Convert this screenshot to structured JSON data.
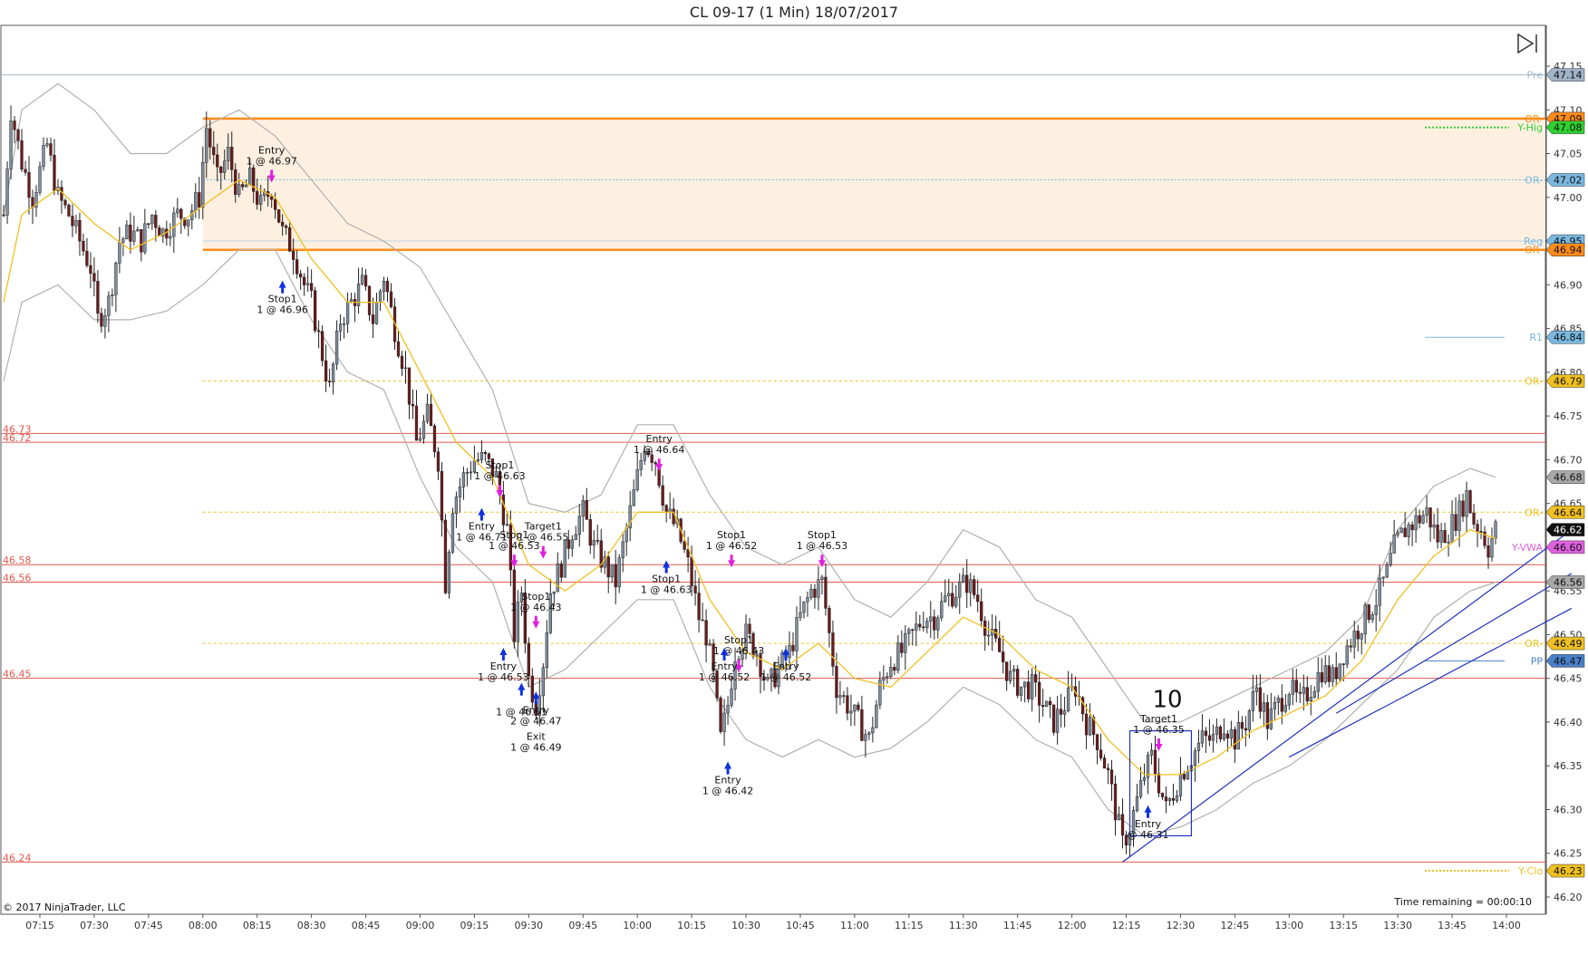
{
  "window": {
    "title": "CL 09-17 (1 Min)  18/07/2017"
  },
  "footer": {
    "copyright": "© 2017 NinjaTrader, LLC",
    "time_remaining": "Time remaining = 00:00:10"
  },
  "colors": {
    "up_candle": "#7f8f9f",
    "down_candle": "#6b1a1a",
    "ema": "#f0c020",
    "bands": "#b0b0b0",
    "or_range_fill": "#fdf0e0",
    "or_line": "#ff8c1a",
    "red_level": "#e05a4f",
    "yellow_dash": "#f0c020",
    "entry_arrow": "#1030e0",
    "exit_arrow": "#e020e0",
    "trendline": "#2030c0"
  },
  "chart_data": {
    "type": "candlestick",
    "symbol": "CL 09-17",
    "interval": "1 Min",
    "date": "18/07/2017",
    "ylim": [
      46.18,
      47.17
    ],
    "y_ticks": [
      46.2,
      46.25,
      46.3,
      46.35,
      46.4,
      46.45,
      46.5,
      46.55,
      46.6,
      46.65,
      46.7,
      46.75,
      46.8,
      46.85,
      46.9,
      46.95,
      47.0,
      47.05,
      47.1,
      47.15
    ],
    "x_ticks": [
      "07:15",
      "07:30",
      "07:45",
      "08:00",
      "08:15",
      "08:30",
      "08:45",
      "09:00",
      "09:15",
      "09:30",
      "09:45",
      "10:00",
      "10:15",
      "10:30",
      "10:45",
      "11:00",
      "11:15",
      "11:30",
      "11:45",
      "12:00",
      "12:15",
      "12:30",
      "12:45",
      "13:00",
      "13:15",
      "13:30",
      "13:45",
      "14:00"
    ],
    "x_tick_minutes": [
      435,
      450,
      465,
      480,
      495,
      510,
      525,
      540,
      555,
      570,
      585,
      600,
      615,
      630,
      645,
      660,
      675,
      690,
      705,
      720,
      735,
      750,
      765,
      780,
      795,
      810,
      825,
      840
    ],
    "close_path": [
      [
        425,
        46.98
      ],
      [
        427,
        47.1
      ],
      [
        430,
        47.04
      ],
      [
        433,
        47.0
      ],
      [
        437,
        47.06
      ],
      [
        440,
        47.0
      ],
      [
        443,
        46.98
      ],
      [
        446,
        46.95
      ],
      [
        449,
        46.92
      ],
      [
        451,
        46.86
      ],
      [
        454,
        46.88
      ],
      [
        457,
        46.95
      ],
      [
        460,
        46.96
      ],
      [
        463,
        46.95
      ],
      [
        466,
        46.98
      ],
      [
        469,
        46.96
      ],
      [
        473,
        46.98
      ],
      [
        476,
        46.98
      ],
      [
        479,
        47.0
      ],
      [
        481,
        47.08
      ],
      [
        484,
        47.02
      ],
      [
        487,
        47.05
      ],
      [
        490,
        47.0
      ],
      [
        493,
        47.02
      ],
      [
        496,
        46.99
      ],
      [
        499,
        47.01
      ],
      [
        502,
        46.96
      ],
      [
        505,
        46.94
      ],
      [
        508,
        46.9
      ],
      [
        510,
        46.88
      ],
      [
        513,
        46.82
      ],
      [
        515,
        46.78
      ],
      [
        518,
        46.86
      ],
      [
        521,
        46.88
      ],
      [
        524,
        46.9
      ],
      [
        527,
        46.86
      ],
      [
        530,
        46.91
      ],
      [
        533,
        46.85
      ],
      [
        536,
        46.8
      ],
      [
        539,
        46.72
      ],
      [
        542,
        46.75
      ],
      [
        545,
        46.7
      ],
      [
        547,
        46.56
      ],
      [
        549,
        46.65
      ],
      [
        552,
        46.68
      ],
      [
        555,
        46.7
      ],
      [
        558,
        46.7
      ],
      [
        561,
        46.68
      ],
      [
        564,
        46.62
      ],
      [
        566,
        46.5
      ],
      [
        568,
        46.55
      ],
      [
        570,
        46.45
      ],
      [
        572,
        46.42
      ],
      [
        574,
        46.47
      ],
      [
        576,
        46.55
      ],
      [
        579,
        46.58
      ],
      [
        582,
        46.62
      ],
      [
        585,
        46.64
      ],
      [
        588,
        46.6
      ],
      [
        591,
        46.58
      ],
      [
        594,
        46.56
      ],
      [
        597,
        46.62
      ],
      [
        600,
        46.68
      ],
      [
        602,
        46.72
      ],
      [
        605,
        46.7
      ],
      [
        608,
        46.64
      ],
      [
        611,
        46.62
      ],
      [
        614,
        46.58
      ],
      [
        617,
        46.52
      ],
      [
        619,
        46.5
      ],
      [
        621,
        46.45
      ],
      [
        623,
        46.38
      ],
      [
        625,
        46.42
      ],
      [
        627,
        46.48
      ],
      [
        630,
        46.5
      ],
      [
        633,
        46.48
      ],
      [
        636,
        46.44
      ],
      [
        639,
        46.46
      ],
      [
        642,
        46.48
      ],
      [
        645,
        46.52
      ],
      [
        648,
        46.55
      ],
      [
        651,
        46.56
      ],
      [
        653,
        46.5
      ],
      [
        655,
        46.44
      ],
      [
        658,
        46.42
      ],
      [
        661,
        46.4
      ],
      [
        664,
        46.38
      ],
      [
        667,
        46.44
      ],
      [
        670,
        46.47
      ],
      [
        673,
        46.48
      ],
      [
        676,
        46.5
      ],
      [
        679,
        46.52
      ],
      [
        682,
        46.52
      ],
      [
        685,
        46.54
      ],
      [
        688,
        46.55
      ],
      [
        691,
        46.56
      ],
      [
        694,
        46.54
      ],
      [
        697,
        46.5
      ],
      [
        700,
        46.48
      ],
      [
        703,
        46.45
      ],
      [
        706,
        46.44
      ],
      [
        709,
        46.44
      ],
      [
        712,
        46.42
      ],
      [
        715,
        46.4
      ],
      [
        718,
        46.42
      ],
      [
        721,
        46.44
      ],
      [
        724,
        46.4
      ],
      [
        727,
        46.38
      ],
      [
        730,
        46.34
      ],
      [
        732,
        46.3
      ],
      [
        734,
        46.26
      ],
      [
        736,
        46.28
      ],
      [
        738,
        46.31
      ],
      [
        740,
        46.34
      ],
      [
        742,
        46.36
      ],
      [
        744,
        46.33
      ],
      [
        746,
        46.3
      ],
      [
        748,
        46.32
      ],
      [
        750,
        46.34
      ],
      [
        753,
        46.36
      ],
      [
        756,
        46.38
      ],
      [
        759,
        46.38
      ],
      [
        762,
        46.4
      ],
      [
        765,
        46.38
      ],
      [
        768,
        46.4
      ],
      [
        771,
        46.44
      ],
      [
        774,
        46.4
      ],
      [
        777,
        46.42
      ],
      [
        780,
        46.44
      ],
      [
        783,
        46.42
      ],
      [
        786,
        46.44
      ],
      [
        789,
        46.46
      ],
      [
        792,
        46.45
      ],
      [
        795,
        46.48
      ],
      [
        798,
        46.5
      ],
      [
        801,
        46.52
      ],
      [
        804,
        46.54
      ],
      [
        807,
        46.57
      ],
      [
        809,
        46.6
      ],
      [
        812,
        46.62
      ],
      [
        815,
        46.63
      ],
      [
        818,
        46.64
      ],
      [
        821,
        46.61
      ],
      [
        824,
        46.62
      ],
      [
        827,
        46.64
      ],
      [
        829,
        46.66
      ],
      [
        831,
        46.63
      ],
      [
        833,
        46.62
      ],
      [
        835,
        46.6
      ],
      [
        837,
        46.62
      ]
    ],
    "ema_path": [
      [
        425,
        46.88
      ],
      [
        430,
        46.98
      ],
      [
        440,
        47.01
      ],
      [
        450,
        46.97
      ],
      [
        460,
        46.94
      ],
      [
        470,
        46.96
      ],
      [
        480,
        46.99
      ],
      [
        490,
        47.02
      ],
      [
        500,
        47.0
      ],
      [
        510,
        46.93
      ],
      [
        520,
        46.88
      ],
      [
        530,
        46.88
      ],
      [
        540,
        46.8
      ],
      [
        550,
        46.72
      ],
      [
        560,
        46.68
      ],
      [
        570,
        46.58
      ],
      [
        580,
        46.55
      ],
      [
        590,
        46.58
      ],
      [
        600,
        46.64
      ],
      [
        610,
        46.64
      ],
      [
        620,
        46.54
      ],
      [
        630,
        46.48
      ],
      [
        640,
        46.46
      ],
      [
        650,
        46.49
      ],
      [
        660,
        46.45
      ],
      [
        670,
        46.44
      ],
      [
        680,
        46.48
      ],
      [
        690,
        46.52
      ],
      [
        700,
        46.5
      ],
      [
        710,
        46.46
      ],
      [
        720,
        46.44
      ],
      [
        730,
        46.38
      ],
      [
        740,
        46.34
      ],
      [
        750,
        46.34
      ],
      [
        760,
        46.36
      ],
      [
        770,
        46.39
      ],
      [
        780,
        46.41
      ],
      [
        790,
        46.43
      ],
      [
        800,
        46.47
      ],
      [
        810,
        46.54
      ],
      [
        820,
        46.59
      ],
      [
        830,
        46.62
      ],
      [
        837,
        46.61
      ]
    ],
    "upper_band_path": [
      [
        425,
        46.98
      ],
      [
        430,
        47.1
      ],
      [
        440,
        47.13
      ],
      [
        450,
        47.1
      ],
      [
        460,
        47.05
      ],
      [
        470,
        47.05
      ],
      [
        480,
        47.08
      ],
      [
        490,
        47.1
      ],
      [
        500,
        47.07
      ],
      [
        510,
        47.02
      ],
      [
        520,
        46.97
      ],
      [
        530,
        46.95
      ],
      [
        540,
        46.92
      ],
      [
        550,
        46.85
      ],
      [
        560,
        46.78
      ],
      [
        570,
        46.65
      ],
      [
        580,
        46.64
      ],
      [
        590,
        46.66
      ],
      [
        600,
        46.74
      ],
      [
        610,
        46.74
      ],
      [
        620,
        46.66
      ],
      [
        630,
        46.6
      ],
      [
        640,
        46.58
      ],
      [
        650,
        46.6
      ],
      [
        660,
        46.54
      ],
      [
        670,
        46.52
      ],
      [
        680,
        46.56
      ],
      [
        690,
        46.62
      ],
      [
        700,
        46.6
      ],
      [
        710,
        46.54
      ],
      [
        720,
        46.52
      ],
      [
        730,
        46.46
      ],
      [
        740,
        46.4
      ],
      [
        750,
        46.4
      ],
      [
        760,
        46.42
      ],
      [
        770,
        46.44
      ],
      [
        780,
        46.46
      ],
      [
        790,
        46.48
      ],
      [
        800,
        46.52
      ],
      [
        810,
        46.62
      ],
      [
        820,
        46.67
      ],
      [
        830,
        46.69
      ],
      [
        837,
        46.68
      ]
    ],
    "lower_band_path": [
      [
        425,
        46.79
      ],
      [
        430,
        46.88
      ],
      [
        440,
        46.9
      ],
      [
        450,
        46.86
      ],
      [
        460,
        46.86
      ],
      [
        470,
        46.87
      ],
      [
        480,
        46.9
      ],
      [
        490,
        46.94
      ],
      [
        500,
        46.94
      ],
      [
        510,
        46.86
      ],
      [
        520,
        46.8
      ],
      [
        530,
        46.78
      ],
      [
        540,
        46.68
      ],
      [
        550,
        46.6
      ],
      [
        560,
        46.56
      ],
      [
        570,
        46.44
      ],
      [
        580,
        46.46
      ],
      [
        590,
        46.5
      ],
      [
        600,
        46.54
      ],
      [
        610,
        46.54
      ],
      [
        620,
        46.44
      ],
      [
        630,
        46.38
      ],
      [
        640,
        46.36
      ],
      [
        650,
        46.38
      ],
      [
        660,
        46.36
      ],
      [
        670,
        46.37
      ],
      [
        680,
        46.4
      ],
      [
        690,
        46.44
      ],
      [
        700,
        46.42
      ],
      [
        710,
        46.38
      ],
      [
        720,
        46.36
      ],
      [
        730,
        46.3
      ],
      [
        740,
        46.27
      ],
      [
        750,
        46.28
      ],
      [
        760,
        46.3
      ],
      [
        770,
        46.33
      ],
      [
        780,
        46.35
      ],
      [
        790,
        46.38
      ],
      [
        800,
        46.42
      ],
      [
        810,
        46.46
      ],
      [
        820,
        46.52
      ],
      [
        830,
        46.55
      ],
      [
        837,
        46.56
      ]
    ],
    "or_range": {
      "from_minute": 480,
      "high": 47.09,
      "low": 46.94
    },
    "left_price_labels": [
      "46.73",
      "46.72",
      "46.58",
      "46.56",
      "46.45",
      "46.24"
    ],
    "red_levels": [
      46.73,
      46.72,
      46.58,
      46.56,
      46.45,
      46.24
    ],
    "yellow_dashed_levels": [
      46.79,
      46.64,
      46.49
    ],
    "right_labels": [
      {
        "tag": "Pre",
        "value": "47.14",
        "color": "#a0b4c8"
      },
      {
        "tag": "OR-",
        "value": "47.09",
        "color": "#ff8c1a"
      },
      {
        "tag": "Y-Hig",
        "value": "47.08",
        "color": "#30d030"
      },
      {
        "tag": "OR-",
        "value": "47.02",
        "color": "#7ab8e0"
      },
      {
        "tag": "Reg",
        "value": "46.95",
        "color": "#7ab8e0"
      },
      {
        "tag": "OR-",
        "value": "46.94",
        "color": "#ff8c1a"
      },
      {
        "tag": "R1",
        "value": "46.84",
        "color": "#7ab8e0"
      },
      {
        "tag": "OR-",
        "value": "46.79",
        "color": "#f0c020"
      },
      {
        "tag": "",
        "value": "46.68",
        "color": "#a8a8a8"
      },
      {
        "tag": "OR-",
        "value": "46.64",
        "color": "#f0c020"
      },
      {
        "tag": "",
        "value": "46.62",
        "color": "#111111"
      },
      {
        "tag": "Y-VWA",
        "value": "46.60",
        "color": "#e060e0"
      },
      {
        "tag": "",
        "value": "46.56",
        "color": "#a8a8a8"
      },
      {
        "tag": "OR-",
        "value": "46.49",
        "color": "#f0c020"
      },
      {
        "tag": "PP",
        "value": "46.47",
        "color": "#4a80c8"
      },
      {
        "tag": "Y-Clo",
        "value": "46.23",
        "color": "#f0c020"
      }
    ],
    "annotations": [
      {
        "text": "Entry",
        "text2": "1 @ 46.97",
        "minute": 499,
        "price": 47.05,
        "dir": "sell"
      },
      {
        "text": "Stop1",
        "text2": "1 @ 46.96",
        "minute": 502,
        "price": 46.88,
        "dir": "buy"
      },
      {
        "text": "Entry",
        "text2": "1 @ 46.71",
        "minute": 557,
        "price": 46.62,
        "dir": "buy"
      },
      {
        "text": "Stop1",
        "text2": "1 @ 46.63",
        "minute": 562,
        "price": 46.69,
        "dir": "sell"
      },
      {
        "text": "Stop1",
        "text2": "1 @ 46.53",
        "minute": 566,
        "price": 46.61,
        "dir": "sell"
      },
      {
        "text": "Target1",
        "text2": "1 @ 46.55",
        "minute": 574,
        "price": 46.62,
        "dir": "sell"
      },
      {
        "text": "Stop1",
        "text2": "1 @ 46.43",
        "minute": 572,
        "price": 46.54,
        "dir": "sell"
      },
      {
        "text": "Entry",
        "text2": "1 @ 46.53",
        "minute": 563,
        "price": 46.46,
        "dir": "buy"
      },
      {
        "text": "",
        "text2": "1 @ 46.51",
        "minute": 568,
        "price": 46.42,
        "dir": "buy"
      },
      {
        "text": "Entry",
        "text2": "2 @ 46.47",
        "minute": 572,
        "price": 46.41,
        "dir": "buy"
      },
      {
        "text": "Exit",
        "text2": "1 @ 46.49",
        "minute": 572,
        "price": 46.38,
        "dir": "none"
      },
      {
        "text": "Entry",
        "text2": "1 @ 46.64",
        "minute": 606,
        "price": 46.72,
        "dir": "sell"
      },
      {
        "text": "Stop1",
        "text2": "1 @ 46.63",
        "minute": 608,
        "price": 46.56,
        "dir": "buy"
      },
      {
        "text": "Stop1",
        "text2": "1 @ 46.52",
        "minute": 626,
        "price": 46.61,
        "dir": "sell"
      },
      {
        "text": "Stop1",
        "text2": "1 @ 46.43",
        "minute": 628,
        "price": 46.49,
        "dir": "sell"
      },
      {
        "text": "Entry",
        "text2": "1 @ 46.52",
        "minute": 624,
        "price": 46.46,
        "dir": "buy"
      },
      {
        "text": "Entry",
        "text2": "1 @ 46.52",
        "minute": 641,
        "price": 46.46,
        "dir": "buy"
      },
      {
        "text": "Stop1",
        "text2": "1 @ 46.53",
        "minute": 651,
        "price": 46.61,
        "dir": "sell"
      },
      {
        "text": "Entry",
        "text2": "1 @ 46.42",
        "minute": 625,
        "price": 46.33,
        "dir": "buy"
      },
      {
        "text": "Target1",
        "text2": "1 @ 46.35",
        "minute": 744,
        "price": 46.4,
        "dir": "sell"
      },
      {
        "text": "Entry",
        "text2": "@ 46.31",
        "minute": 741,
        "price": 46.28,
        "dir": "buy"
      }
    ],
    "box_label": "10",
    "highlight_box": {
      "from_minute": 736,
      "to_minute": 753,
      "high": 46.39,
      "low": 46.27
    },
    "trendlines": [
      {
        "from": [
          734,
          46.24
        ],
        "to": [
          858,
          46.62
        ]
      },
      {
        "from": [
          780,
          46.36
        ],
        "to": [
          858,
          46.53
        ]
      },
      {
        "from": [
          793,
          46.41
        ],
        "to": [
          858,
          46.57
        ]
      }
    ],
    "current_price": "46.62",
    "grid": "off",
    "legend": "none"
  }
}
